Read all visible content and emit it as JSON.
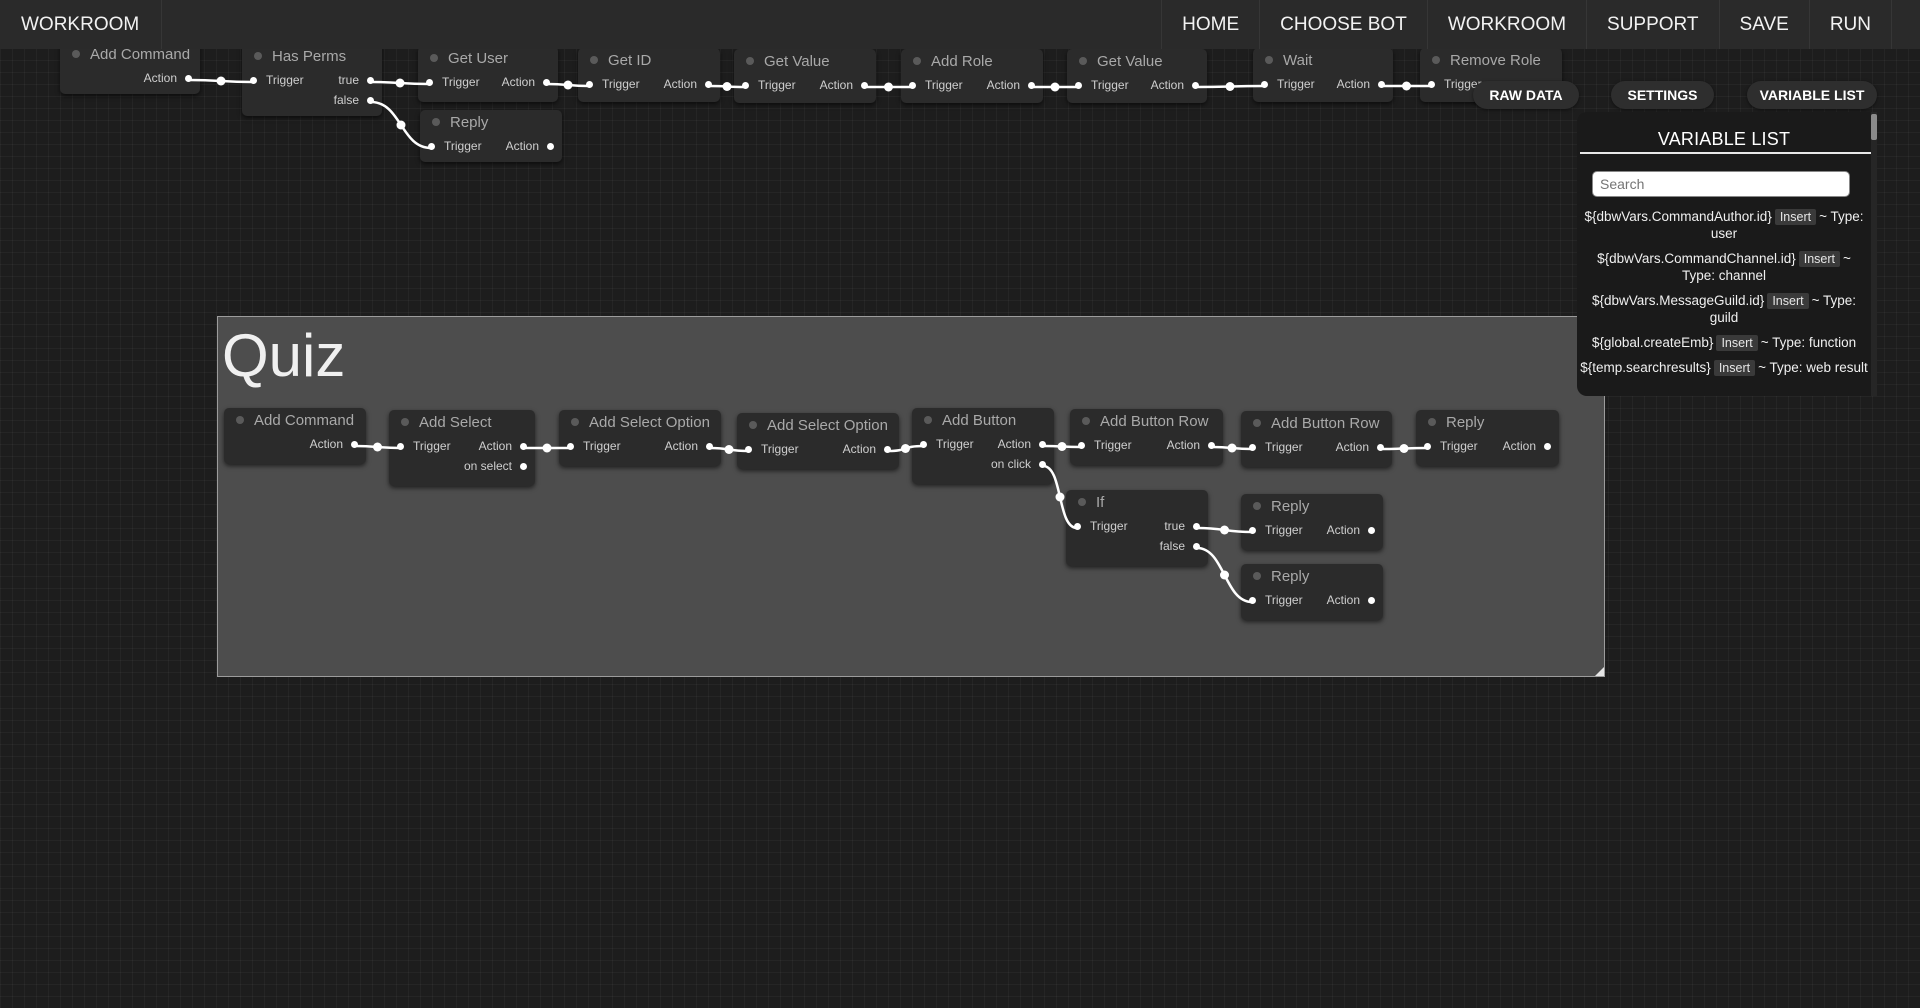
{
  "app": {
    "brand": "WORKROOM"
  },
  "nav": [
    "HOME",
    "CHOOSE BOT",
    "WORKROOM",
    "SUPPORT",
    "SAVE",
    "RUN"
  ],
  "floating_buttons": {
    "raw_data": "RAW DATA",
    "settings": "SETTINGS",
    "variable_list": "VARIABLE LIST"
  },
  "variable_panel": {
    "title": "VARIABLE LIST",
    "search_placeholder": "Search",
    "insert_label": "Insert",
    "items": [
      {
        "name": "${dbwVars.CommandAuthor.id}",
        "type": "~ Type: user"
      },
      {
        "name": "${dbwVars.CommandChannel.id}",
        "type": "~ Type: channel"
      },
      {
        "name": "${dbwVars.MessageGuild.id}",
        "type": "~ Type: guild"
      },
      {
        "name": "${global.createEmb}",
        "type": "~ Type: function"
      },
      {
        "name": "${temp.searchresults}",
        "type": "~ Type: web result"
      }
    ]
  },
  "group": {
    "title": "Quiz"
  },
  "nodes": [
    {
      "id": "t0",
      "title": "Add Command",
      "inputs": [],
      "outputs": [
        "Action"
      ]
    },
    {
      "id": "t1",
      "title": "Has Perms",
      "inputs": [
        "Trigger"
      ],
      "outputs": [
        "true",
        "false"
      ]
    },
    {
      "id": "t2",
      "title": "Get User",
      "inputs": [
        "Trigger"
      ],
      "outputs": [
        "Action"
      ]
    },
    {
      "id": "t3",
      "title": "Reply",
      "inputs": [
        "Trigger"
      ],
      "outputs": [
        "Action"
      ]
    },
    {
      "id": "t4",
      "title": "Get ID",
      "inputs": [
        "Trigger"
      ],
      "outputs": [
        "Action"
      ]
    },
    {
      "id": "t5",
      "title": "Get Value",
      "inputs": [
        "Trigger"
      ],
      "outputs": [
        "Action"
      ]
    },
    {
      "id": "t6",
      "title": "Add Role",
      "inputs": [
        "Trigger"
      ],
      "outputs": [
        "Action"
      ]
    },
    {
      "id": "t7",
      "title": "Get Value",
      "inputs": [
        "Trigger"
      ],
      "outputs": [
        "Action"
      ]
    },
    {
      "id": "t8",
      "title": "Wait",
      "inputs": [
        "Trigger"
      ],
      "outputs": [
        "Action"
      ]
    },
    {
      "id": "t9",
      "title": "Remove Role",
      "inputs": [
        "Trigger"
      ],
      "outputs": []
    },
    {
      "id": "q0",
      "title": "Add Command",
      "inputs": [],
      "outputs": [
        "Action"
      ]
    },
    {
      "id": "q1",
      "title": "Add Select",
      "inputs": [
        "Trigger"
      ],
      "outputs": [
        "Action",
        "on select"
      ]
    },
    {
      "id": "q2",
      "title": "Add Select Option",
      "inputs": [
        "Trigger"
      ],
      "outputs": [
        "Action"
      ]
    },
    {
      "id": "q3",
      "title": "Add Select Option",
      "inputs": [
        "Trigger"
      ],
      "outputs": [
        "Action"
      ]
    },
    {
      "id": "q4",
      "title": "Add Button",
      "inputs": [
        "Trigger"
      ],
      "outputs": [
        "Action",
        "on click"
      ]
    },
    {
      "id": "q5",
      "title": "Add Button Row",
      "inputs": [
        "Trigger"
      ],
      "outputs": [
        "Action"
      ]
    },
    {
      "id": "q6",
      "title": "Add Button Row",
      "inputs": [
        "Trigger"
      ],
      "outputs": [
        "Action"
      ]
    },
    {
      "id": "q7",
      "title": "Reply",
      "inputs": [
        "Trigger"
      ],
      "outputs": [
        "Action"
      ]
    },
    {
      "id": "q8",
      "title": "If",
      "inputs": [
        "Trigger"
      ],
      "outputs": [
        "true",
        "false"
      ]
    },
    {
      "id": "q9",
      "title": "Reply",
      "inputs": [
        "Trigger"
      ],
      "outputs": [
        "Action"
      ]
    },
    {
      "id": "q10",
      "title": "Reply",
      "inputs": [
        "Trigger"
      ],
      "outputs": [
        "Action"
      ]
    }
  ],
  "links": [
    [
      "t0",
      0,
      "t1"
    ],
    [
      "t1",
      0,
      "t2"
    ],
    [
      "t1",
      1,
      "t3"
    ],
    [
      "t2",
      0,
      "t4"
    ],
    [
      "t4",
      0,
      "t5"
    ],
    [
      "t5",
      0,
      "t6"
    ],
    [
      "t6",
      0,
      "t7"
    ],
    [
      "t7",
      0,
      "t8"
    ],
    [
      "t8",
      0,
      "t9"
    ],
    [
      "q0",
      0,
      "q1"
    ],
    [
      "q1",
      0,
      "q2"
    ],
    [
      "q2",
      0,
      "q3"
    ],
    [
      "q3",
      0,
      "q4"
    ],
    [
      "q4",
      0,
      "q5"
    ],
    [
      "q5",
      0,
      "q6"
    ],
    [
      "q6",
      0,
      "q7"
    ],
    [
      "q4",
      1,
      "q8"
    ],
    [
      "q8",
      0,
      "q9"
    ],
    [
      "q8",
      1,
      "q10"
    ]
  ]
}
